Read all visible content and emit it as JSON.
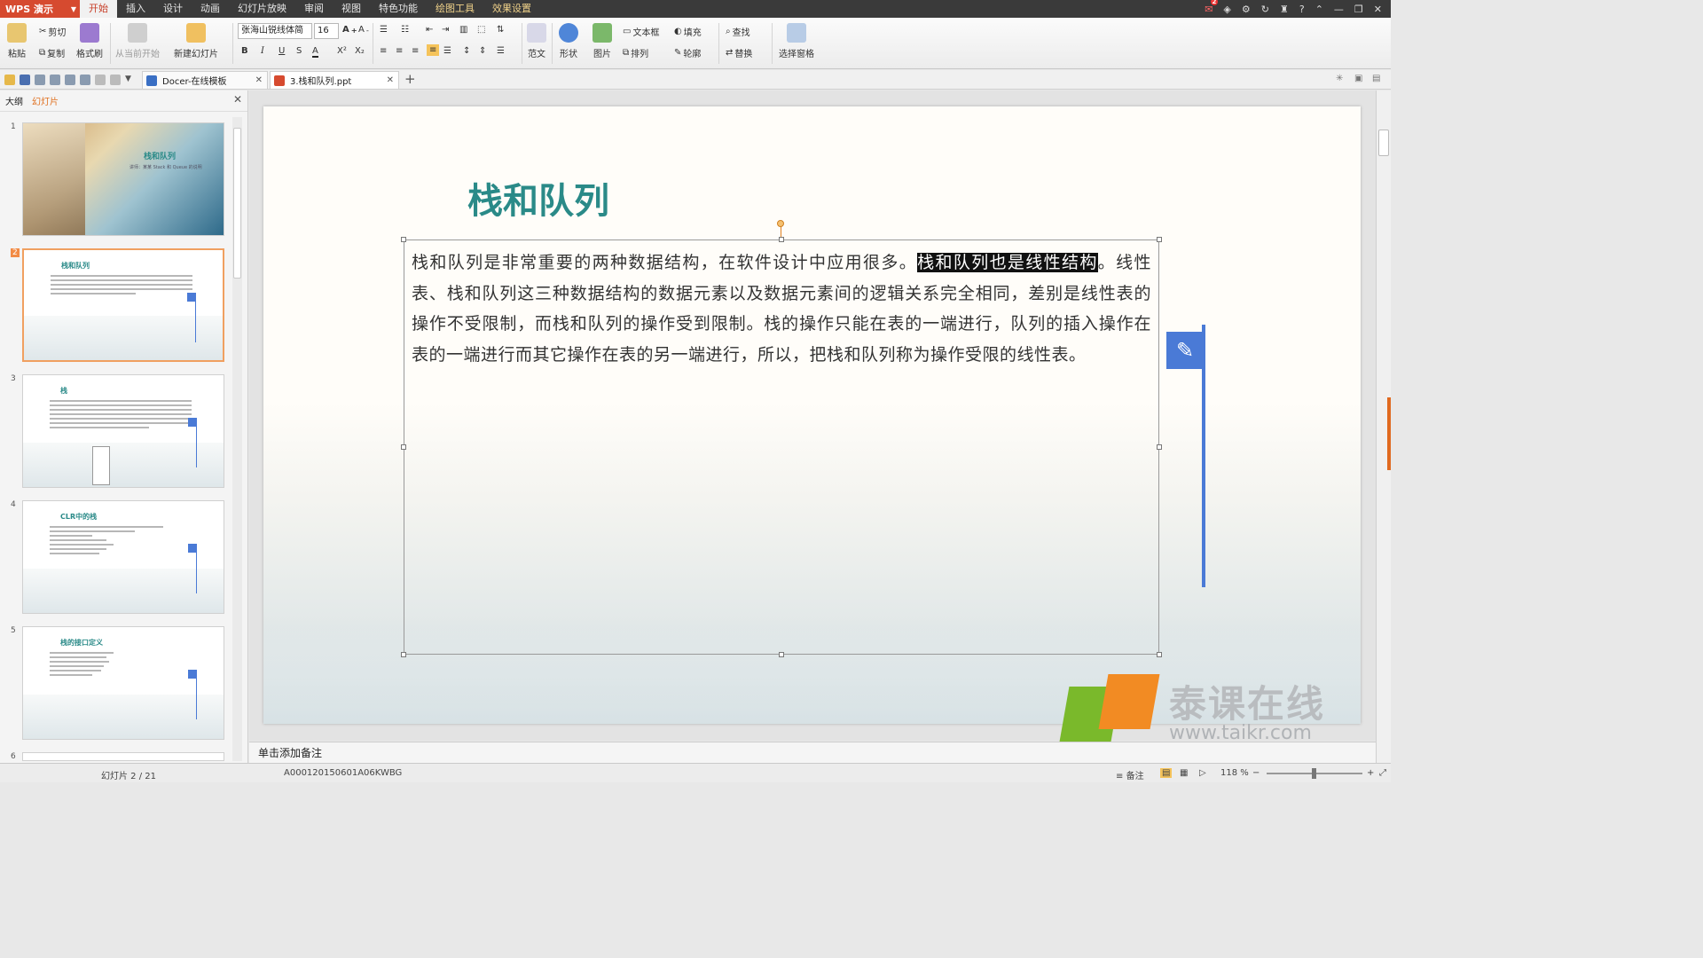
{
  "app": {
    "name": "WPS 演示"
  },
  "menu": [
    "开始",
    "插入",
    "设计",
    "动画",
    "幻灯片放映",
    "审阅",
    "视图",
    "特色功能",
    "绘图工具",
    "效果设置"
  ],
  "ribbon": {
    "paste": "粘贴",
    "cut": "剪切",
    "copy": "复制",
    "format_painter": "格式刷",
    "from_current": "从当前开始",
    "new_slide": "新建幻灯片",
    "font_name": "张海山锐线体简",
    "font_size": "16",
    "sample": "范文",
    "shape": "形状",
    "picture": "图片",
    "textbox": "文本框",
    "arrange": "排列",
    "fill": "填充",
    "outline": "轮廓",
    "find": "查找",
    "replace": "替换",
    "select_pane": "选择窗格",
    "bold": "B",
    "italic": "I",
    "underline": "U",
    "strike": "S",
    "fontcolor": "A",
    "sup": "X²",
    "sub": "X₂"
  },
  "tabs": [
    {
      "label": "Docer-在线模板"
    },
    {
      "label": "3.栈和队列.ppt"
    }
  ],
  "left_panel": {
    "tab_outline": "大纲",
    "tab_slides": "幻灯片",
    "thumbs": [
      {
        "num": "1",
        "title": "栈和队列",
        "sub": "讲师：某某  Stack 和 Queue 的说明"
      },
      {
        "num": "2",
        "title": "栈和队列"
      },
      {
        "num": "3",
        "title": "栈"
      },
      {
        "num": "4",
        "title": "CLR中的栈"
      },
      {
        "num": "5",
        "title": "栈的接口定义"
      }
    ],
    "next_num": "6"
  },
  "slide": {
    "title": "栈和队列",
    "text_before": "栈和队列是非常重要的两种数据结构，在软件设计中应用很多。",
    "text_highlight": "栈和队列也是线性结构",
    "text_after": "。线性表、栈和队列这三种数据结构的数据元素以及数据元素间的逻辑关系完全相同，差别是线性表的操作不受限制，而栈和队列的操作受到限制。栈的操作只能在表的一端进行，队列的插入操作在表的一端进行而其它操作在表的另一端进行，所以，把栈和队列称为操作受限的线性表。"
  },
  "notes_placeholder": "单击添加备注",
  "status": {
    "slide_counter": "幻灯片 2 / 21",
    "code": "A000120150601A06KWBG",
    "notes": "备注",
    "zoom": "118 %",
    "zoom_level": 0.49
  },
  "watermark": {
    "name": "泰课在线",
    "url": "www.taikr.com"
  },
  "colors": {
    "accent_orange": "#d64a2f",
    "title_teal": "#2a8a88",
    "flag_blue": "#4a7ad6",
    "selection_black": "#111111"
  }
}
